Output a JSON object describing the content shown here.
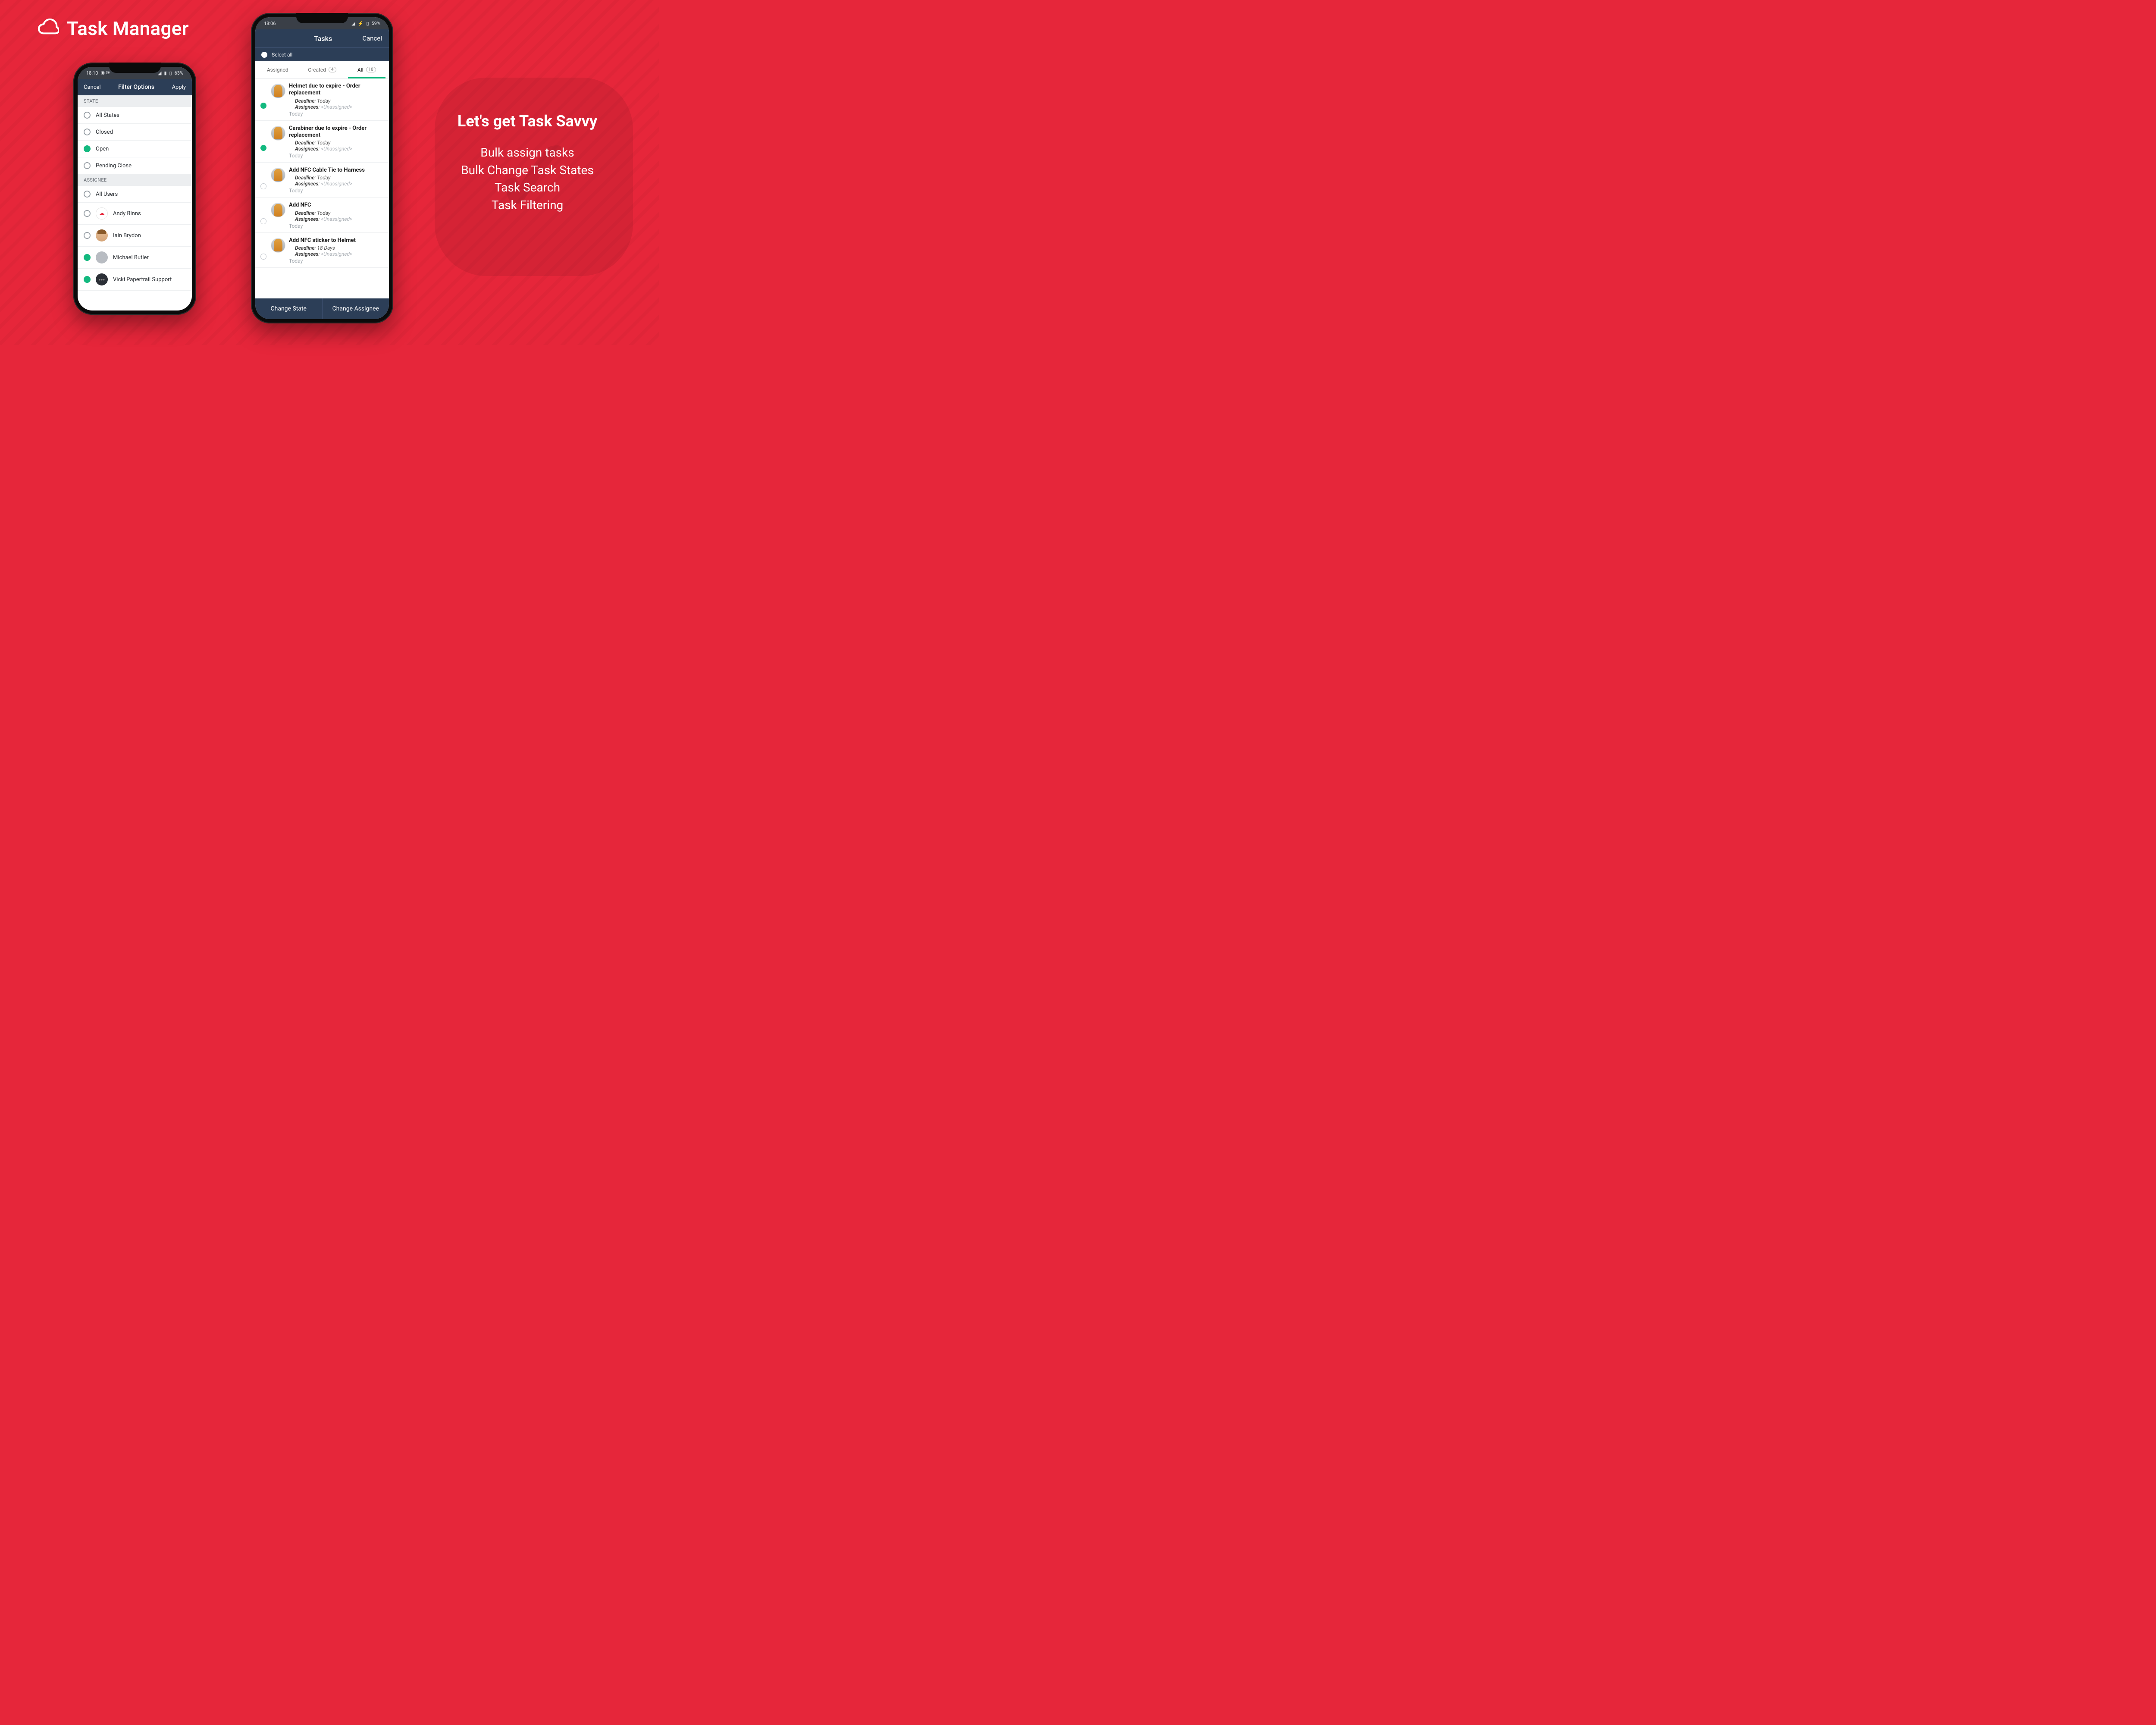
{
  "hero": {
    "title": "Task Manager"
  },
  "marketing": {
    "headline": "Let's get Task Savvy",
    "lines": [
      "Bulk assign tasks",
      "Bulk Change Task States",
      "Task Search",
      "Task Filtering"
    ]
  },
  "phone1": {
    "status": {
      "time": "18:10",
      "battery": "63%"
    },
    "header": {
      "cancel": "Cancel",
      "title": "Filter Options",
      "apply": "Apply"
    },
    "sections": {
      "state": {
        "label": "STATE",
        "options": [
          {
            "label": "All States",
            "selected": false
          },
          {
            "label": "Closed",
            "selected": false
          },
          {
            "label": "Open",
            "selected": true
          },
          {
            "label": "Pending Close",
            "selected": false
          }
        ]
      },
      "assignee": {
        "label": "ASSIGNEE",
        "options": [
          {
            "label": "All Users",
            "selected": false,
            "avatar": "none"
          },
          {
            "label": "Andy Binns",
            "selected": false,
            "avatar": "cloud"
          },
          {
            "label": "Iain Brydon",
            "selected": false,
            "avatar": "face"
          },
          {
            "label": "Michael Butler",
            "selected": true,
            "avatar": "gray"
          },
          {
            "label": "Vicki Papertrail Support",
            "selected": true,
            "avatar": "dark"
          }
        ]
      }
    }
  },
  "phone2": {
    "status": {
      "time": "18:06",
      "battery": "59%"
    },
    "header": {
      "title": "Tasks",
      "cancel": "Cancel"
    },
    "selectAll": "Select all",
    "tabs": {
      "assigned": {
        "label": "Assigned",
        "count": null
      },
      "created": {
        "label": "Created",
        "count": "4"
      },
      "all": {
        "label": "All",
        "count": "10"
      }
    },
    "activeTab": "all",
    "tasks": [
      {
        "title": "Helmet due to expire - Order replacement",
        "deadline": "Today",
        "assignees": "<Unassigned>",
        "date": "Today",
        "selected": true
      },
      {
        "title": "Carabiner due to expire - Order replacement",
        "deadline": "Today",
        "assignees": "<Unassigned>",
        "date": "Today",
        "selected": true
      },
      {
        "title": "Add NFC Cable Tie to Harness",
        "deadline": "Today",
        "assignees": "<Unassigned>",
        "date": "Today",
        "selected": false
      },
      {
        "title": "Add NFC",
        "deadline": "Today",
        "assignees": "<Unassigned>",
        "date": "Today",
        "selected": false
      },
      {
        "title": "Add NFC sticker to Helmet",
        "deadline": "18 Days",
        "assignees": "<Unassigned>",
        "date": "Today",
        "selected": false
      }
    ],
    "labels": {
      "deadline": "Deadline",
      "assignees": "Assignees"
    },
    "actions": {
      "changeState": "Change State",
      "changeAssignee": "Change Assignee"
    }
  }
}
